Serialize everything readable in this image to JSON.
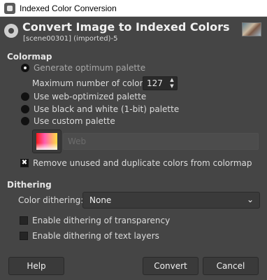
{
  "window": {
    "title": "Indexed Color Conversion"
  },
  "header": {
    "title": "Convert Image to Indexed Colors",
    "subtitle": "[scene00301] (imported)-5"
  },
  "colormap": {
    "section_title": "Colormap",
    "options": [
      {
        "label": "Generate optimum palette",
        "selected": true
      },
      {
        "label": "Use web-optimized palette",
        "selected": false
      },
      {
        "label": "Use black and white (1-bit) palette",
        "selected": false
      },
      {
        "label": "Use custom palette",
        "selected": false
      }
    ],
    "max_colors_label": "Maximum number of colors:",
    "max_colors_value": "127",
    "custom_palette_name": "Web",
    "remove_unused_label": "Remove unused and duplicate colors from colormap",
    "remove_unused_checked": true
  },
  "dithering": {
    "section_title": "Dithering",
    "color_dithering_label": "Color dithering:",
    "color_dithering_value": "None",
    "transparency_label": "Enable dithering of transparency",
    "transparency_checked": false,
    "text_layers_label": "Enable dithering of text layers",
    "text_layers_checked": false
  },
  "buttons": {
    "help": "Help",
    "convert": "Convert",
    "cancel": "Cancel"
  },
  "checkmark_glyph": "✖",
  "spin_up_glyph": "▲",
  "spin_down_glyph": "▼",
  "chevron_glyph": "⌄",
  "colors": {
    "background": "#454545",
    "text": "#dcdcdc",
    "disabled_text": "#a8a8a8"
  }
}
